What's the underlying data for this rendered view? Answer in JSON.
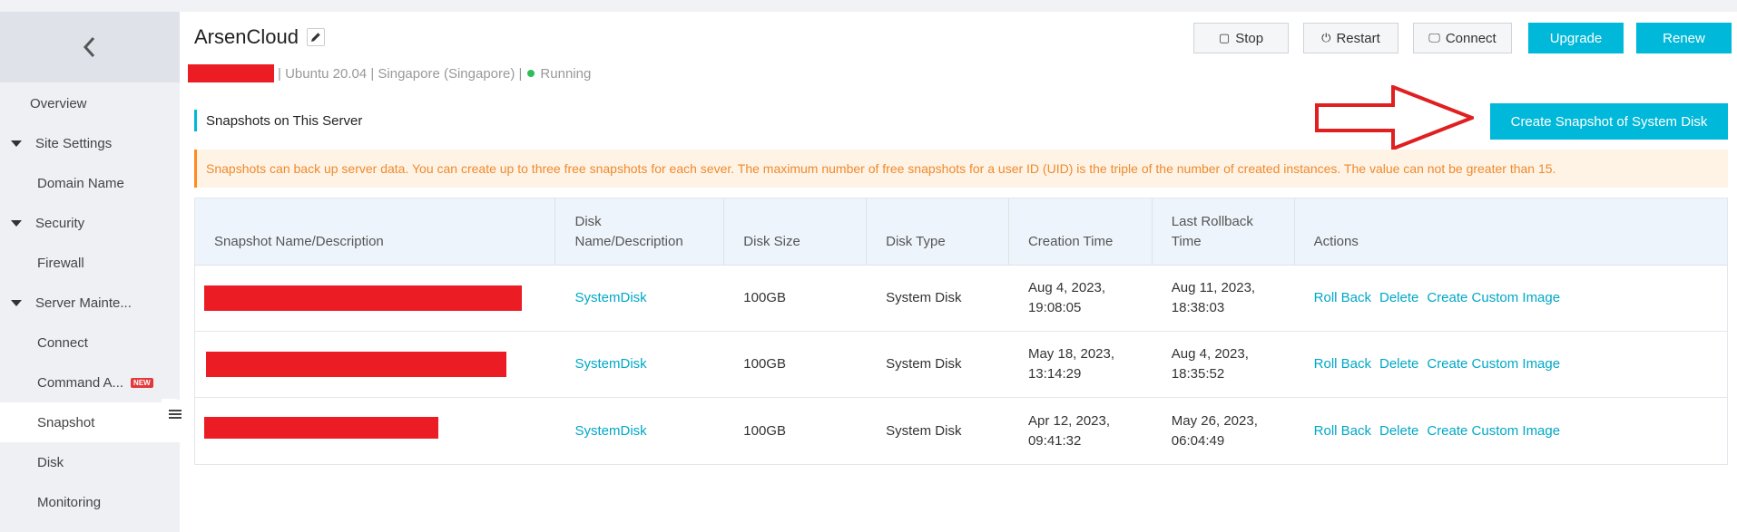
{
  "app": {
    "title": "ArsenCloud",
    "os": "Ubuntu 20.04",
    "region": "Singapore (Singapore)",
    "status": "Running",
    "separator": "|"
  },
  "toolbar": {
    "stop": "Stop",
    "restart": "Restart",
    "connect": "Connect",
    "upgrade": "Upgrade",
    "renew": "Renew"
  },
  "sidebar": {
    "overview": "Overview",
    "site_settings": "Site Settings",
    "domain_name": "Domain Name",
    "security": "Security",
    "firewall": "Firewall",
    "server_maintenance": "Server Mainte...",
    "connect": "Connect",
    "command": "Command A...",
    "new_badge": "NEW",
    "snapshot": "Snapshot",
    "disk": "Disk",
    "monitoring": "Monitoring"
  },
  "section": {
    "title": "Snapshots on This Server",
    "create_button": "Create Snapshot of System Disk",
    "notice": "Snapshots can back up server data. You can create up to three free snapshots for each sever. The maximum number of free snapshots for a user ID (UID) is the triple of the number of created instances. The value can not be greater than 15."
  },
  "table": {
    "headers": {
      "name": "Snapshot Name/Description",
      "disk": "Disk Name/Description",
      "size": "Disk Size",
      "type": "Disk Type",
      "created": "Creation Time",
      "rollback": "Last Rollback Time",
      "actions": "Actions"
    },
    "rows": [
      {
        "disk": "SystemDisk",
        "size": "100GB",
        "type": "System Disk",
        "created": "Aug 4, 2023, 19:08:05",
        "rollback": "Aug 11, 2023, 18:38:03"
      },
      {
        "disk": "SystemDisk",
        "size": "100GB",
        "type": "System Disk",
        "created": "May 18, 2023, 13:14:29",
        "rollback": "Aug 4, 2023, 18:35:52"
      },
      {
        "disk": "SystemDisk",
        "size": "100GB",
        "type": "System Disk",
        "created": "Apr 12, 2023, 09:41:32",
        "rollback": "May 26, 2023, 06:04:49"
      }
    ],
    "actions": {
      "rollback": "Roll Back",
      "delete": "Delete",
      "custom_image": "Create Custom Image"
    }
  },
  "colors": {
    "accent": "#00b8d9",
    "link": "#00a8c6",
    "notice_text": "#ef8a2c",
    "notice_bg": "#fff3e6",
    "status_running": "#2dbe5a",
    "annotation_arrow": "#e02020"
  },
  "icons": {
    "back": "chevron-left-icon",
    "edit": "pencil-icon",
    "stop": "stop-square-icon",
    "restart": "power-icon",
    "connect": "monitor-icon",
    "collapse": "list-collapse-icon"
  }
}
